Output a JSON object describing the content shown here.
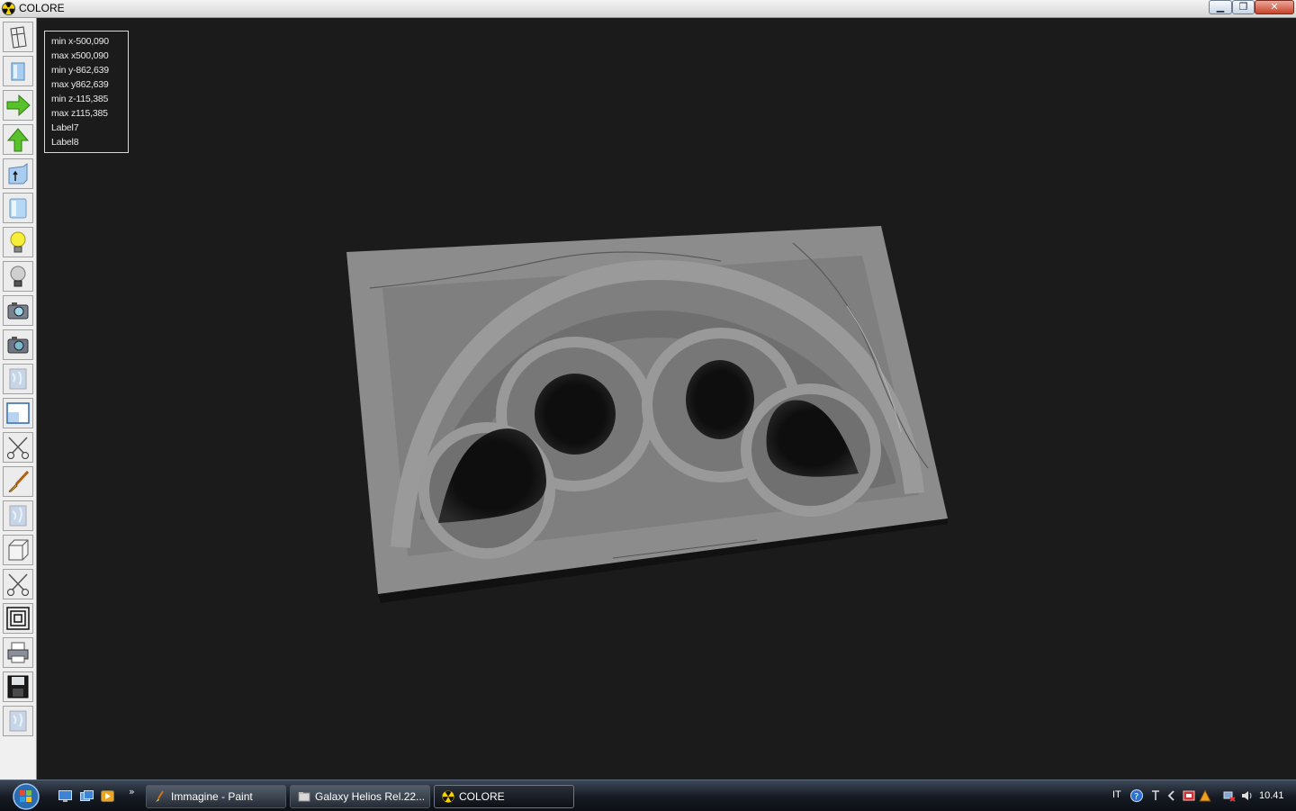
{
  "window": {
    "title": "COLORE"
  },
  "info": {
    "lines": [
      "min x-500,090",
      "max x500,090",
      "min y-862,639",
      "max y862,639",
      "min z-115,385",
      "max z115,385",
      "Label7",
      "Label8"
    ]
  },
  "toolbar": {
    "tools": [
      "wireframe-icon",
      "solid-view-icon",
      "arrow-right-icon",
      "arrow-up-icon",
      "extrude-icon",
      "cylinder-icon",
      "light-on-icon",
      "light-off-icon",
      "camera-icon",
      "camera-alt-icon",
      "texture-icon",
      "window-view-icon",
      "scissors-icon",
      "paint-brush-icon",
      "texture-alt-icon",
      "box-icon",
      "scissors-alt-icon",
      "offset-icon",
      "printer-icon",
      "save-icon",
      "texture-blank-icon"
    ]
  },
  "taskbar": {
    "more": "»",
    "items": [
      {
        "label": "Immagine - Paint",
        "icon": "paint-icon",
        "active": false
      },
      {
        "label": "Galaxy Helios  Rel.22...",
        "icon": "folder-icon",
        "active": false
      },
      {
        "label": "COLORE",
        "icon": "colore-icon",
        "active": true
      }
    ],
    "lang": "IT",
    "clock": "10.41"
  }
}
